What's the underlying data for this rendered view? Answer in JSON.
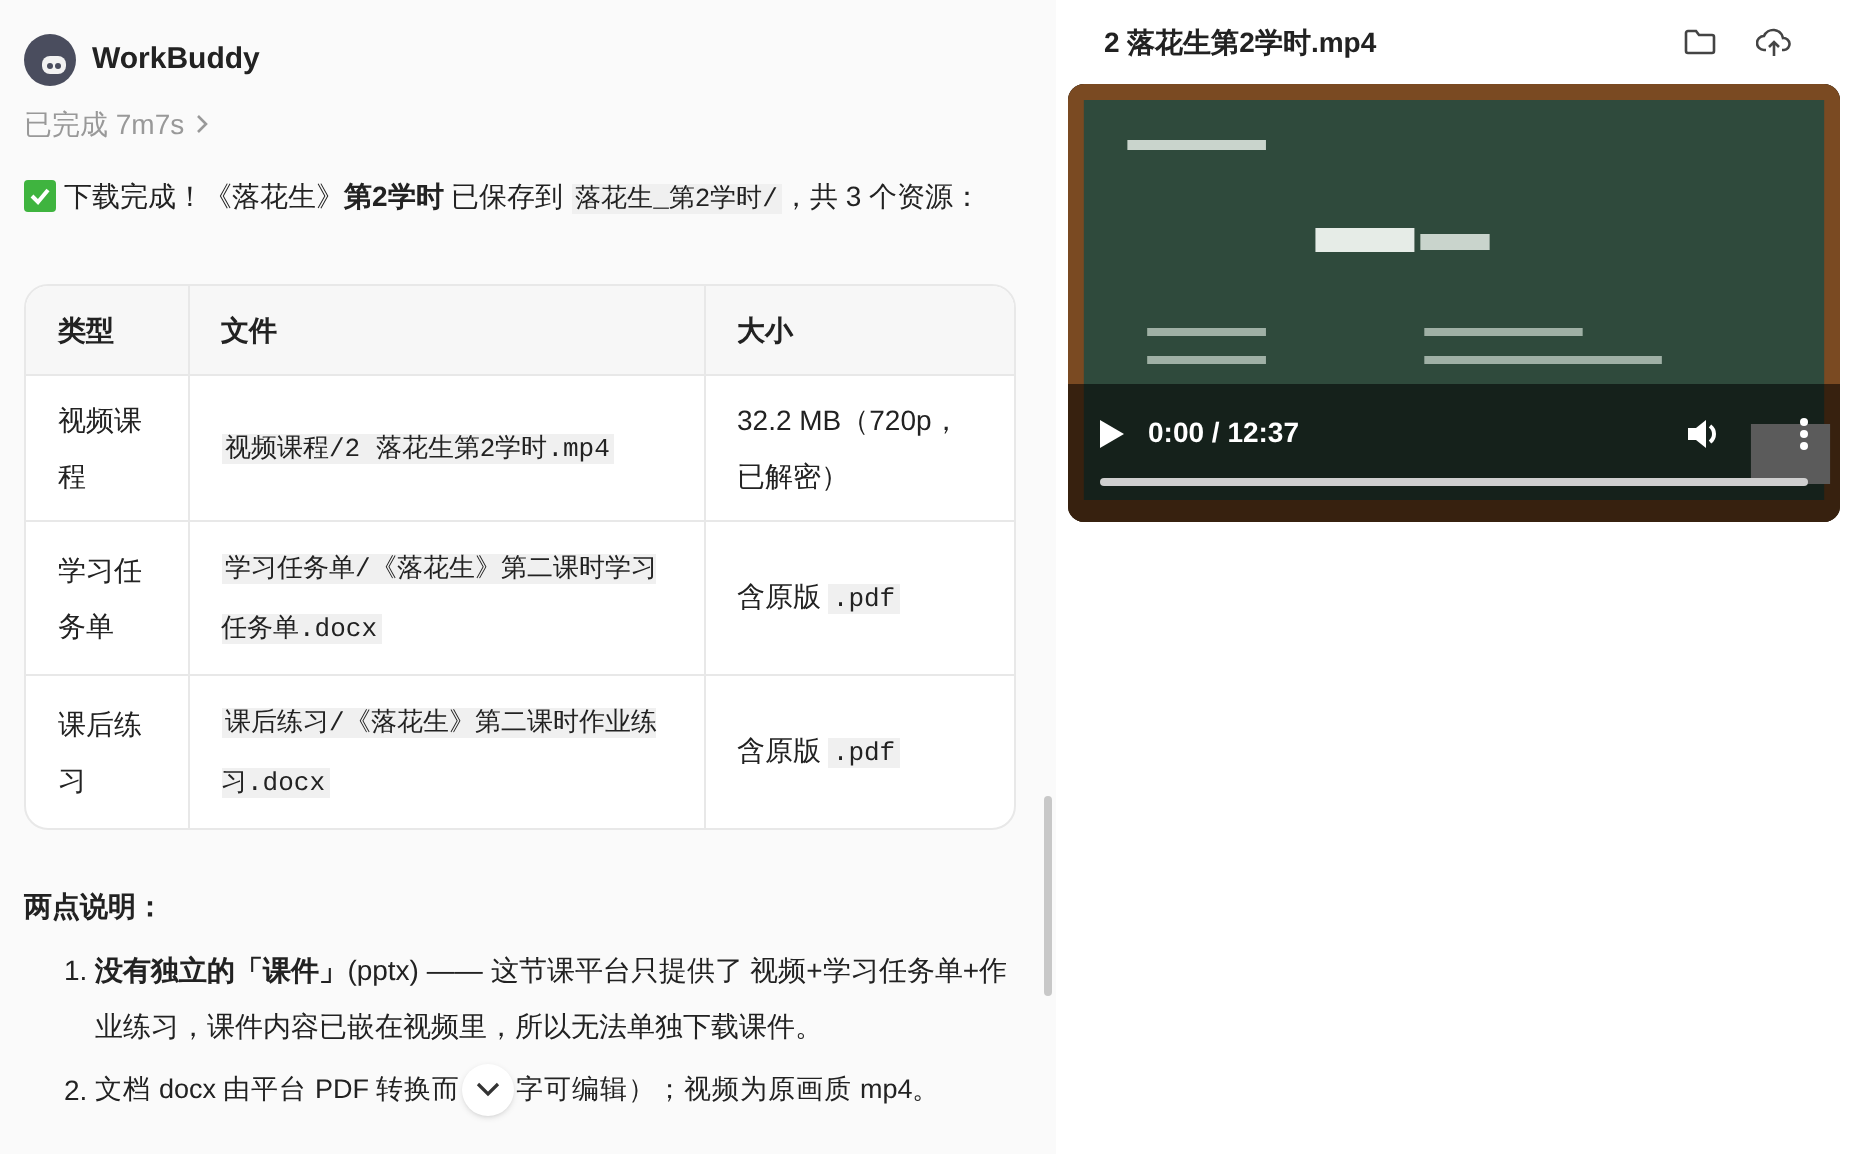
{
  "header": {
    "app_name": "WorkBuddy",
    "status": "已完成 7m7s"
  },
  "message": {
    "parts": [
      {
        "kind": "text",
        "text": "下载完成！《落花生》"
      },
      {
        "kind": "bold",
        "text": "第2学时"
      },
      {
        "kind": "text",
        "text": " 已保存到 "
      },
      {
        "kind": "code",
        "text": "落花生_第2学时/"
      },
      {
        "kind": "text",
        "text": "，共 3 个资源："
      }
    ]
  },
  "table": {
    "columns": [
      "类型",
      "文件",
      "大小"
    ],
    "rows": [
      [
        [
          {
            "kind": "text",
            "text": "视频课程"
          }
        ],
        [
          {
            "kind": "code",
            "text": "视频课程/2 落花生第2学时.mp4"
          }
        ],
        [
          {
            "kind": "text",
            "text": "32.2 MB（720p，已解密）"
          }
        ]
      ],
      [
        [
          {
            "kind": "text",
            "text": "学习任务单"
          }
        ],
        [
          {
            "kind": "code",
            "text": "学习任务单/《落花生》第二课时学习任务单.docx"
          }
        ],
        [
          {
            "kind": "text",
            "text": "含原版 "
          },
          {
            "kind": "code",
            "text": ".pdf"
          }
        ]
      ],
      [
        [
          {
            "kind": "text",
            "text": "课后练习"
          }
        ],
        [
          {
            "kind": "code",
            "text": "课后练习/《落花生》第二课时作业练习.docx"
          }
        ],
        [
          {
            "kind": "text",
            "text": "含原版 "
          },
          {
            "kind": "code",
            "text": ".pdf"
          }
        ]
      ]
    ]
  },
  "notes": {
    "heading": "两点说明：",
    "items": [
      {
        "number": "1.",
        "text": "**没有独立的「课件」**(pptx) —— 这节课平台只提供了 视频+学习任务单+作业练习，课件内容已嵌在视频里，所以无法单独下载课件。"
      },
      {
        "number": "2.",
        "text": "文档 docx 由平台 PDF 转换而",
        "text_after": "字可编辑）；视频为原画质 mp4。"
      }
    ]
  },
  "preview": {
    "title": "2 落花生第2学时.mp4",
    "video": {
      "time": "0:00 / 12:37"
    }
  }
}
